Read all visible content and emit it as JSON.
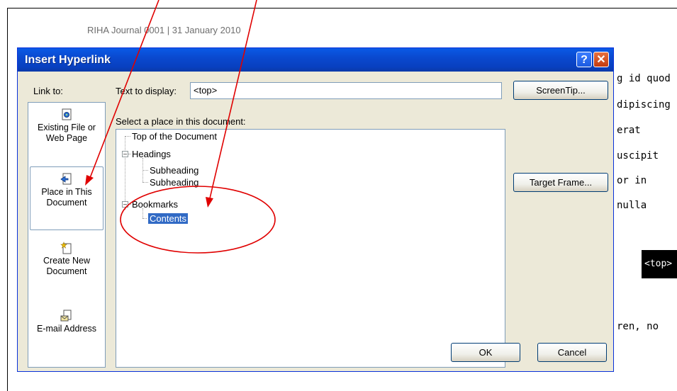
{
  "document": {
    "header": "RIHA Journal 0001 | 31 January 2010",
    "background_lines": [
      "g id quod",
      "dipiscing",
      " erat",
      "uscipit",
      "or in",
      "nulla",
      "ren, no"
    ],
    "tag": "<top>"
  },
  "dialog": {
    "title": "Insert Hyperlink",
    "help_label": "?",
    "close_label": "✕",
    "link_to_label": "Link to:",
    "text_to_display_label": "Text to display:",
    "text_to_display_value": "<top>",
    "select_place_label": "Select a place in this document:",
    "link_options": [
      {
        "label": "Existing File or Web Page",
        "icon": "existing-file-icon"
      },
      {
        "label": "Place in This Document",
        "icon": "place-in-document-icon",
        "selected": true
      },
      {
        "label": "Create New Document",
        "icon": "new-document-icon"
      },
      {
        "label": "E-mail Address",
        "icon": "email-icon"
      }
    ],
    "tree": {
      "top": "Top of the Document",
      "headings": "Headings",
      "subheadings": [
        "Subheading",
        "Subheading"
      ],
      "bookmarks": "Bookmarks",
      "bookmark_items": [
        "Contents"
      ]
    },
    "buttons": {
      "screentip": "ScreenTip...",
      "target_frame": "Target Frame...",
      "ok": "OK",
      "cancel": "Cancel"
    }
  },
  "colors": {
    "title_bar": "#0a49cf",
    "selection": "#316ac5",
    "annotation": "#e00000"
  }
}
